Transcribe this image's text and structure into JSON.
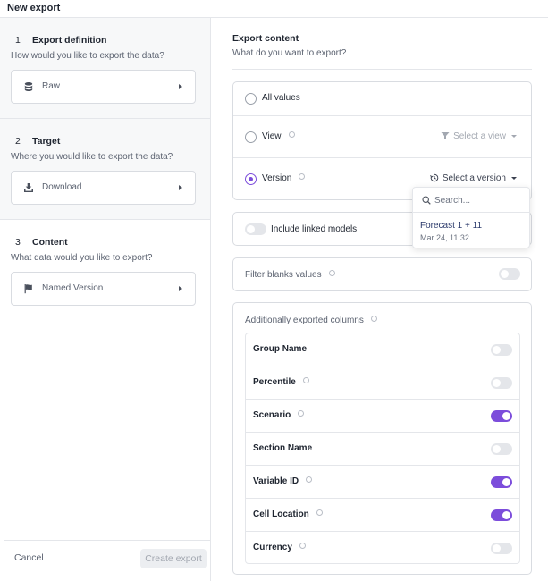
{
  "window": {
    "title": "New export"
  },
  "steps": [
    {
      "num": "1",
      "title": "Export definition",
      "subtitle": "How would you like to export the data?",
      "value": "Raw",
      "icon": "database-icon"
    },
    {
      "num": "2",
      "title": "Target",
      "subtitle": "Where you would like to export the data?",
      "value": "Download",
      "icon": "download-icon"
    },
    {
      "num": "3",
      "title": "Content",
      "subtitle": "What data would you like to export?",
      "value": "Named Version",
      "icon": "flag-icon"
    }
  ],
  "footer": {
    "cancel": "Cancel",
    "create": "Create export"
  },
  "content": {
    "title": "Export content",
    "subtitle": "What do you want to export?",
    "options": [
      {
        "label": "All values",
        "selected": false
      },
      {
        "label": "View",
        "selected": false,
        "action": "Select a view"
      },
      {
        "label": "Version",
        "selected": true,
        "action": "Select a version"
      }
    ],
    "linked_models": {
      "label": "Include linked models",
      "on": false
    },
    "filter_blanks": {
      "label": "Filter blanks values",
      "on": false
    },
    "columns": {
      "title": "Additionally exported columns",
      "items": [
        {
          "label": "Group Name",
          "on": false
        },
        {
          "label": "Percentile",
          "on": false
        },
        {
          "label": "Scenario",
          "on": true
        },
        {
          "label": "Section Name",
          "on": false
        },
        {
          "label": "Variable ID",
          "on": true
        },
        {
          "label": "Cell Location",
          "on": true
        },
        {
          "label": "Currency",
          "on": false
        }
      ]
    }
  },
  "version_dropdown": {
    "search_placeholder": "Search...",
    "items": [
      {
        "name": "Forecast 1 + 11",
        "date": "Mar 24, 11:32"
      }
    ]
  },
  "colors": {
    "accent": "#7c4ddb",
    "border": "#d9dce1",
    "muted_text": "#5b6270"
  }
}
